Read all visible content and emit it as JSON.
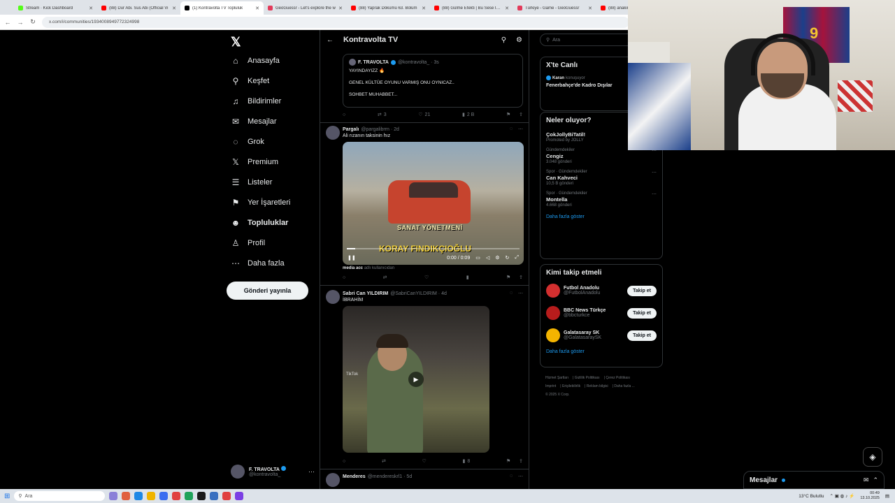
{
  "browser": {
    "tabs": [
      {
        "title": "Stream · Kick Dashboard",
        "color": "#53fc18",
        "active": false
      },
      {
        "title": "(88) Dur Abi. Sus Abi (Official Vi",
        "color": "#ff0000",
        "active": false
      },
      {
        "title": "(1) Kontravolta TV Topluluk",
        "color": "#000000",
        "active": true
      },
      {
        "title": "GeoGuessr - Let's explore the w",
        "color": "#e23a5a",
        "active": false
      },
      {
        "title": "(88) Yaprak Dökümü 63. Bölüm",
        "color": "#ff0000",
        "active": false
      },
      {
        "title": "(88) Gülme Efekti | Bu Sese İnan",
        "color": "#ff0000",
        "active": false
      },
      {
        "title": "Türkiye - Game - GeoGuessr",
        "color": "#e23a5a",
        "active": false
      },
      {
        "title": "(88) anakin",
        "color": "#ff0000",
        "active": false
      }
    ],
    "url": "x.com/i/communities/1934008949772324998"
  },
  "sidebar": {
    "items": [
      {
        "label": "Anasayfa",
        "icon": "⌂"
      },
      {
        "label": "Keşfet",
        "icon": "⚲"
      },
      {
        "label": "Bildirimler",
        "icon": "♫"
      },
      {
        "label": "Mesajlar",
        "icon": "✉"
      },
      {
        "label": "Grok",
        "icon": "◌"
      },
      {
        "label": "Premium",
        "icon": "𝕏"
      },
      {
        "label": "Listeler",
        "icon": "☰"
      },
      {
        "label": "Yer İşaretleri",
        "icon": "⚑"
      },
      {
        "label": "Topluluklar",
        "icon": "☻"
      },
      {
        "label": "Profil",
        "icon": "♙"
      },
      {
        "label": "Daha fazla",
        "icon": "⋯"
      }
    ],
    "post_button": "Gönderi yayınla",
    "me": {
      "name": "F. TRAVOLTA",
      "handle": "@kontravolta_"
    }
  },
  "feed": {
    "title": "Kontravolta TV",
    "quote": {
      "name": "F. TRAVOLTA",
      "handle": "@kontravolta_ · 3s",
      "line1": "YAYINDAYIZZ 🔥",
      "line2": "GENEL KÜLTÜE OYUNU VARMIŞ ONU OYNICAZ..",
      "line3": "SOHBET MUHABBET...",
      "retweets": "3",
      "likes": "21",
      "views": "2 B"
    },
    "post1": {
      "name": "Pargalı",
      "handle": "@pargalibrrn · 2d",
      "text": "Ali rızanın taksinin hız",
      "caption1": "SANAT YÖNETMENİ",
      "caption2": "KORAY FINDIKÇIOĞLU",
      "time": "0:00 / 0:09",
      "progress": 0.05,
      "media_note_user": "media acc",
      "media_note_rest": "adlı kullanıcıdan"
    },
    "post2": {
      "name": "Sabri Can YILDIRIM",
      "handle": "@SabriCanYILDIRIM · 4d",
      "text": "İBRAHİM",
      "watermark": "TikTok",
      "views": "8"
    },
    "post3": {
      "name": "Menderes",
      "handle": "@mendereskrl1 · 5d"
    }
  },
  "right": {
    "search_placeholder": "Ara",
    "live": {
      "title": "X'te Canlı",
      "host": "Karan",
      "status": "konuşuyor",
      "topic": "Fenerbahçe'de Kadro Dışılar"
    },
    "trends": {
      "title": "Neler oluyor?",
      "promoted_title": "ÇokJollyBiTatil!",
      "promoted_by": "Promoted by JOLLY",
      "items": [
        {
          "category": "Gündemdekiler",
          "name": "Cengiz",
          "count": "3.048 gönderi"
        },
        {
          "category": "Spor · Gündemdekiler",
          "name": "Can Kahveci",
          "count": "10,5 B gönderi"
        },
        {
          "category": "Spor · Gündemdekiler",
          "name": "Montella",
          "count": "4.668 gönderi"
        }
      ],
      "more": "Daha fazla göster"
    },
    "who_to_follow": {
      "title": "Kimi takip etmeli",
      "items": [
        {
          "name": "Futbol Anadolu",
          "handle": "@FutbolAnadolu",
          "button": "Takip et",
          "color": "#d32f2f"
        },
        {
          "name": "BBC News Türkçe",
          "handle": "@bbcturkce",
          "button": "Takip et",
          "color": "#b71c1c"
        },
        {
          "name": "Galatasaray SK",
          "handle": "@GalatasaraySK",
          "button": "Takip et",
          "color": "#f4b400"
        }
      ],
      "more": "Daha fazla göster"
    },
    "footer": {
      "l1": "Hizmet Şartları",
      "l2": "Gizlilik Politikası",
      "l3": "Çerez Politikası",
      "l4": "Imprint",
      "l5": "Erişilebilirlik",
      "l6": "Reklam bilgisi",
      "l7": "Daha fazla ...",
      "copy": "© 2025 X Corp."
    }
  },
  "dock": {
    "label": "Mesajlar"
  },
  "taskbar": {
    "search": "Ara",
    "weather": "13°C  Bulutlu",
    "time": "00:49",
    "date": "13.10.2025"
  }
}
